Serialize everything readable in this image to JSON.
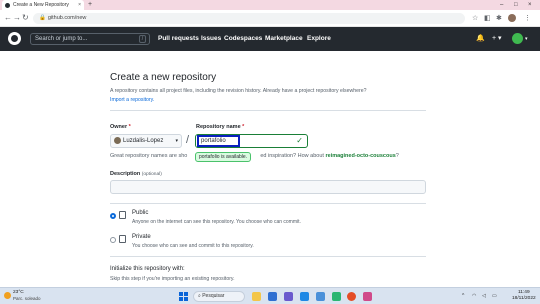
{
  "browser": {
    "tab_title": "Create a New Repository",
    "tab_close": "×",
    "new_tab": "+",
    "window_controls": [
      "–",
      "□",
      "×"
    ],
    "url": "github.com/new",
    "nav": {
      "back": "←",
      "forward": "→",
      "reload": "↻"
    },
    "extensions": [
      "☆",
      "◧"
    ]
  },
  "header": {
    "search_placeholder": "Search or jump to...",
    "search_shortcut": "/",
    "nav_items": [
      "Pull requests",
      "Issues",
      "Codespaces",
      "Marketplace",
      "Explore"
    ],
    "bell": "🔔",
    "plus": "+ ▾",
    "avatar_caret": "▾"
  },
  "page": {
    "title": "Create a new repository",
    "intro": "A repository contains all project files, including the revision history. Already have a project repository elsewhere?",
    "import_link": "Import a repository.",
    "owner_label": "Owner",
    "required_mark": "*",
    "owner_value": "Luzdalis-Lopez",
    "owner_caret": "▾",
    "separator": "/",
    "repo_label": "Repository name",
    "repo_value": "portafolio",
    "repo_valid_icon": "✓",
    "hint_prefix": "Great repository names are sho",
    "tooltip": "portafolio is available.",
    "hint_suffix": "ed inspiration? How about",
    "suggestion": "reimagined-octo-couscous",
    "hint_end": "?",
    "description_label": "Description",
    "description_optional": "(optional)",
    "description_value": "",
    "visibility": [
      {
        "title": "Public",
        "desc": "Anyone on the internet can see this repository. You choose who can commit.",
        "selected": true
      },
      {
        "title": "Private",
        "desc": "You choose who can see and commit to this repository.",
        "selected": false
      }
    ],
    "init_title": "Initialize this repository with:",
    "init_desc": "Skip this step if you're importing an existing repository."
  },
  "taskbar": {
    "weather_temp": "23°C",
    "weather_cond": "Parc. soleado",
    "search_label": "Pesquisar",
    "tray_caret": "^",
    "time": "11:49",
    "date": "18/11/2022"
  },
  "colors": {
    "header_bg": "#24292f",
    "accent_green": "#1a7f37",
    "link_blue": "#0969da",
    "focus_box": "#0a1fbf"
  }
}
